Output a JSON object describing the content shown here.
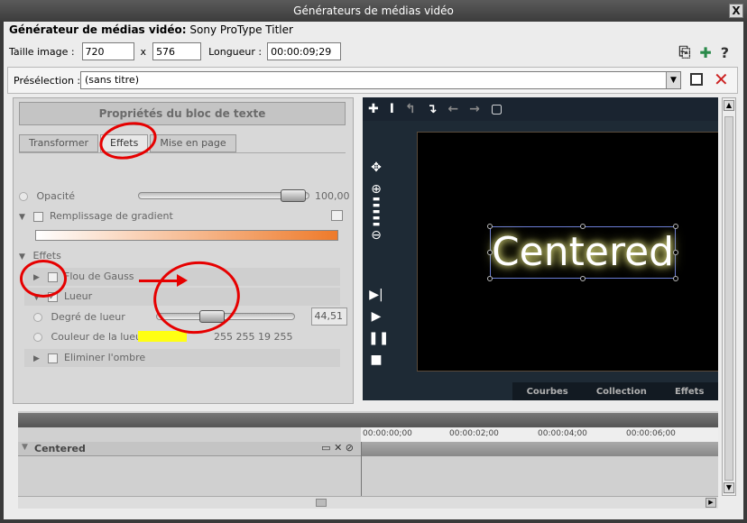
{
  "window": {
    "title": "Générateurs de médias vidéo",
    "close": "X"
  },
  "generator": {
    "label": "Générateur de médias vidéo:",
    "name": "Sony ProType Titler"
  },
  "image_size": {
    "label": "Taille image :",
    "width": "720",
    "x": "x",
    "height": "576"
  },
  "length": {
    "label": "Longueur :",
    "value": "00:00:09;29"
  },
  "top_icons": {
    "help": "?"
  },
  "preset": {
    "label": "Présélection :",
    "value": "(sans titre)"
  },
  "panel": {
    "title": "Propriétés du bloc de texte",
    "tabs": [
      "Transformer",
      "Effets",
      "Mise en page"
    ],
    "opacity": {
      "label": "Opacité",
      "value": "100,00",
      "level": 1.0
    },
    "gradient_fill": {
      "label": "Remplissage de gradient"
    },
    "effects_label": "Effets",
    "gauss": {
      "label": "Flou de Gauss"
    },
    "glow": {
      "label": "Lueur",
      "checked": "✓"
    },
    "glow_degree": {
      "label": "Degré de lueur",
      "value": "44,51"
    },
    "glow_color": {
      "label": "Couleur de la lueur",
      "rgba": "255 255 19 255",
      "hex": "#ffff13"
    },
    "shadow": {
      "label": "Eliminer l'ombre"
    }
  },
  "preview": {
    "text": "Centered",
    "tabs": [
      "Courbes",
      "Collection",
      "Effets"
    ]
  },
  "timeline": {
    "track": "Centered",
    "ticks": [
      "00:00:00;00",
      "00:00:02;00",
      "00:00:04;00",
      "00:00:06;00"
    ]
  }
}
